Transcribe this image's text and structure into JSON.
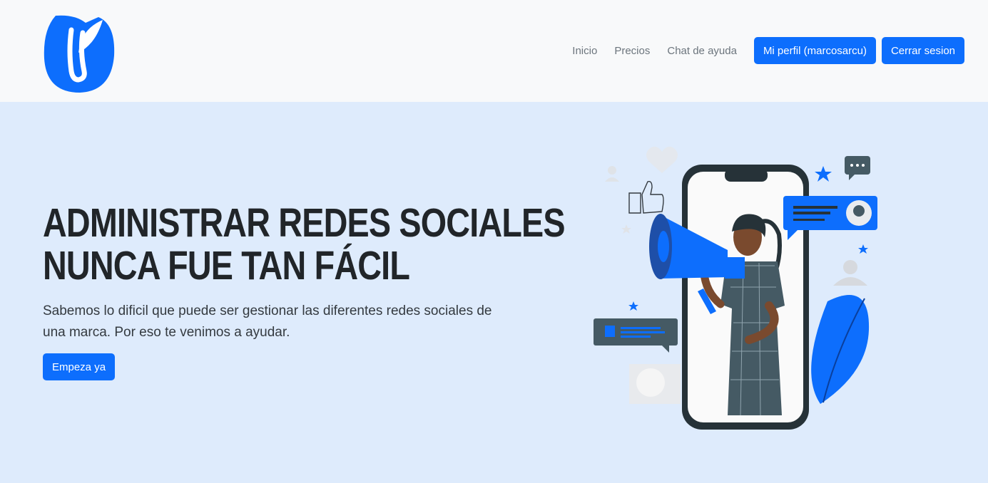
{
  "nav": {
    "links": [
      "Inicio",
      "Precios",
      "Chat de ayuda"
    ],
    "profile_button": "Mi perfil (marcosarcu)",
    "logout_button": "Cerrar sesion"
  },
  "hero": {
    "title_line1": "ADMINISTRAR REDES SOCIALES",
    "title_line2": "NUNCA FUE TAN FÁCIL",
    "subtitle_line1": "Sabemos lo dificil que puede ser gestionar las diferentes redes sociales de",
    "subtitle_line2": "una marca. Por eso te venimos a ayudar.",
    "cta_button": "Empeza ya"
  },
  "colors": {
    "primary": "#0d6efd",
    "navbar_bg": "#f8f9fa",
    "hero_bg": "#deebfc",
    "text_dark": "#212529"
  },
  "icons": {
    "logo": "leaf-logo-icon",
    "illustration": "woman-megaphone-phone-illustration"
  }
}
